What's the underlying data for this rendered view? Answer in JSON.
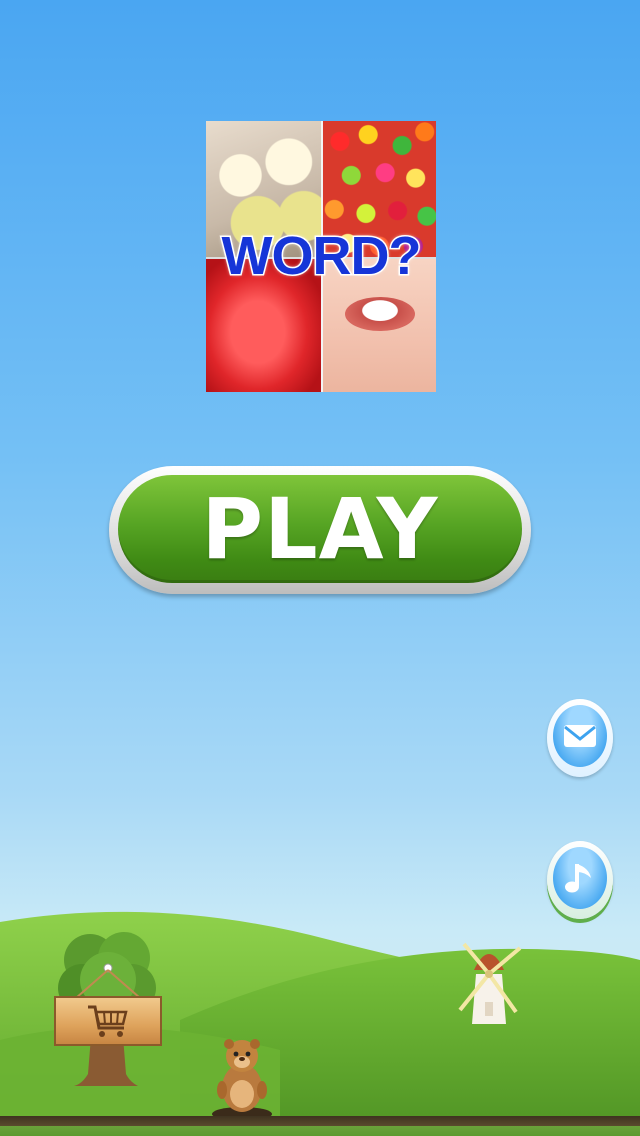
{
  "logo": {
    "word": "WORD?"
  },
  "play_button": {
    "label": "PLAY"
  },
  "side_buttons": [
    {
      "icon": "mail-icon"
    },
    {
      "icon": "music-note-icon"
    }
  ],
  "scene": {
    "shop_icon": "shopping-cart-icon"
  },
  "colors": {
    "sky_top": "#4aa6f2",
    "play_green": "#57a524",
    "logo_text_blue": "#1635d8",
    "grass": "#7cc23a"
  }
}
